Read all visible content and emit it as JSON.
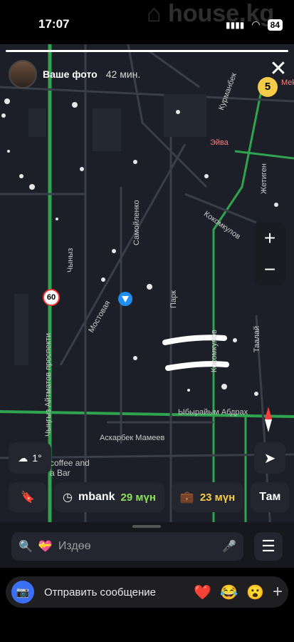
{
  "status_bar": {
    "time": "17:07",
    "battery": "84"
  },
  "watermark": "house.kg",
  "story": {
    "title": "Ваше фото",
    "time": "42 мин.",
    "progress_percent": 100
  },
  "map": {
    "street_labels": [
      "Чыныз",
      "Самойленко",
      "Мостовая",
      "Парк",
      "Кокомкулов",
      "Курманбек",
      "Жетиген",
      "Таалай",
      "Ыбырайым Абдрах",
      "Аскарбек Мамеев",
      "Чыңгыз Айтматов проспекти",
      "Кокомкулов"
    ],
    "poi_labels": [
      "Эйва",
      "Меk",
      "coffee and",
      "a Bar"
    ],
    "speed_sign": "60",
    "zoom_badge": "5"
  },
  "controls": {
    "zoom_in": "+",
    "zoom_out": "−"
  },
  "weather": {
    "temp": "1°"
  },
  "chips": [
    {
      "label": "mbank",
      "time": "29 мүн",
      "icon": "clock-icon",
      "color": "#8de05c"
    },
    {
      "label": "",
      "time": "23 мүн",
      "icon": "briefcase-icon",
      "color": "#f4cc4a"
    },
    {
      "label": "Там",
      "time": "",
      "icon": "",
      "color": "#ffffff"
    }
  ],
  "search": {
    "placeholder": "Издөө"
  },
  "message": {
    "placeholder": "Отправить сообщение",
    "reactions": [
      "❤️",
      "😂",
      "😮"
    ]
  },
  "colors": {
    "accent_blue": "#3b6ff5",
    "road_green": "#2fa34e",
    "badge_yellow": "#f4cc4a"
  }
}
